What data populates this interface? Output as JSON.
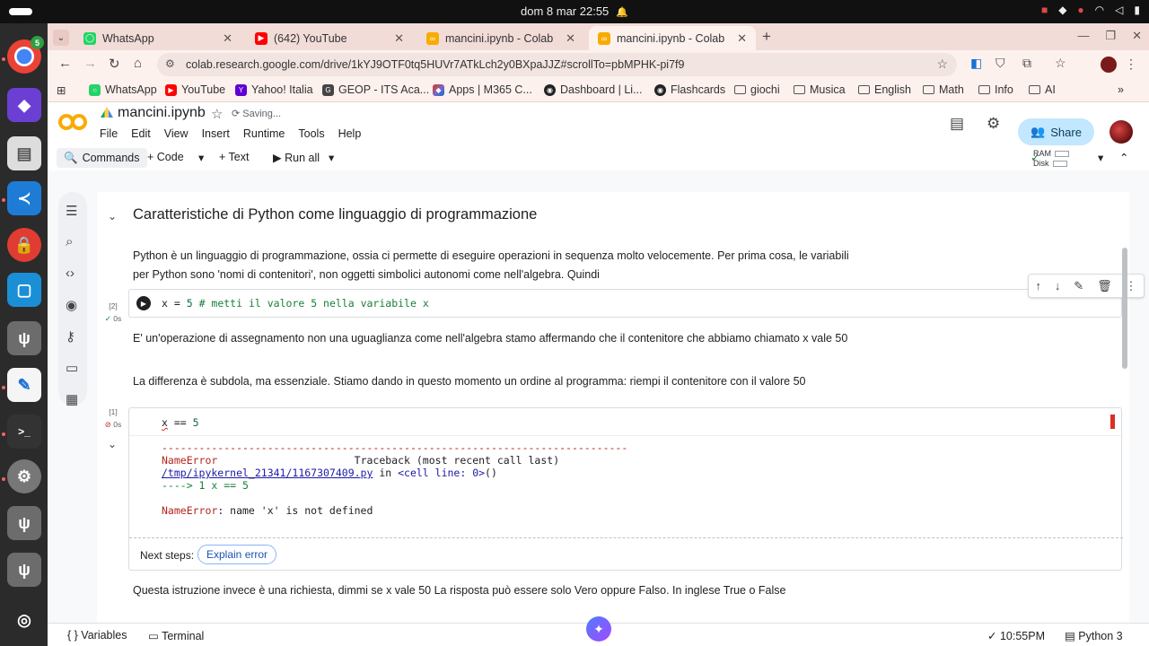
{
  "system": {
    "clock": "dom 8 mar  22:55"
  },
  "dock": {
    "chrome_badge": "5"
  },
  "browser": {
    "tabs": [
      {
        "label": "WhatsApp"
      },
      {
        "label": "(642) YouTube"
      },
      {
        "label": "mancini.ipynb - Colab"
      },
      {
        "label": "mancini.ipynb - Colab"
      }
    ],
    "url": "colab.research.google.com/drive/1kYJ9OTF0tq5HUVr7ATkLch2y0BXpaJJZ#scrollTo=pbMPHK-pi7f9",
    "bookmarks": [
      {
        "label": "WhatsApp"
      },
      {
        "label": "YouTube"
      },
      {
        "label": "Yahoo! Italia"
      },
      {
        "label": "GEOP - ITS Aca..."
      },
      {
        "label": "Apps | M365 C..."
      },
      {
        "label": "Dashboard | Li..."
      },
      {
        "label": "Flashcards"
      },
      {
        "label": "giochi"
      },
      {
        "label": "Musica"
      },
      {
        "label": "English"
      },
      {
        "label": "Math"
      },
      {
        "label": "Info"
      },
      {
        "label": "AI"
      }
    ]
  },
  "colab": {
    "title": "mancini.ipynb",
    "saving": "Saving...",
    "menu": [
      "File",
      "Edit",
      "View",
      "Insert",
      "Runtime",
      "Tools",
      "Help"
    ],
    "share_label": "Share",
    "toolbar": {
      "commands": "Commands",
      "code": "+ Code",
      "text": "+ Text",
      "run_all": "Run all",
      "ram": "RAM",
      "disk": "Disk"
    },
    "section_title": "Caratteristiche di Python come linguaggio di programmazione",
    "text1": "Python è un linguaggio di programmazione, ossia ci permette di eseguire operazioni in sequenza molto velocemente. Per prima cosa, le variabili per Python sono 'nomi di contenitori', non oggetti simbolici autonomi come nell'algebra. Quindi",
    "cell1": {
      "exec_count": "[2]",
      "time": "0s",
      "code_var": "x = ",
      "code_num": "5",
      "code_comment": " # metti il valore 5 nella variabile x"
    },
    "text2": "E' un'operazione di assegnamento non una uguaglianza come nell'algebra stamo affermando che il contenitore che abbiamo chiamato x vale 50",
    "text3": "La differenza è subdola, ma essenziale. Stiamo dando in questo momento un ordine al programma: riempi il contenitore con il valore 50",
    "cell2": {
      "exec_count": "[1]",
      "time": "0s",
      "code_var": "x",
      "code_op": " == ",
      "code_num": "5",
      "out_dashes": "---------------------------------------------------------------------------",
      "out_err_name": "NameError",
      "out_traceback": "Traceback (most recent call last)",
      "out_file": "/tmp/ipykernel_21341/1167307409.py",
      "out_in": " in ",
      "out_cell": "<cell line: 0>",
      "out_paren": "()",
      "out_arrow": "----> 1 x == 5",
      "out_err_label": "NameError",
      "out_err_msg": ": name 'x' is not defined",
      "next_steps": "Next steps:",
      "explain_error": "Explain error"
    },
    "text4": "Questa istruzione invece è una richiesta, dimmi se x vale 50 La risposta può essere solo Vero oppure Falso. In inglese True o False",
    "status": {
      "variables": "Variables",
      "terminal": "Terminal",
      "time": "10:55PM",
      "kernel": "Python 3"
    }
  }
}
